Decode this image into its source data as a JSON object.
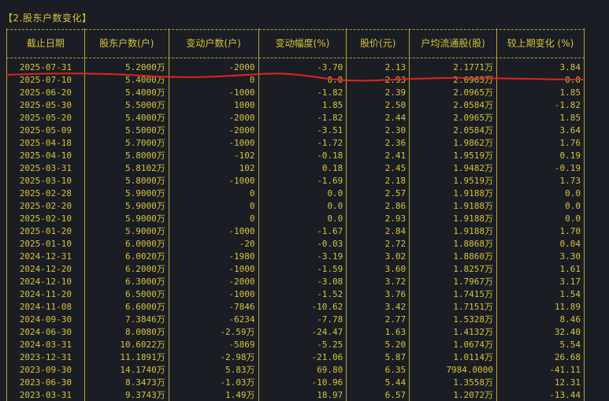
{
  "title": "【2.股东户数变化】",
  "columns": [
    "截止日期",
    "股东户数(户)",
    "变动户数(户)",
    "变动幅度(%)",
    "股价(元)",
    "户均流通股(股)",
    "较上期变化 (%)"
  ],
  "rows": [
    [
      "2025-07-31",
      "5.2000万",
      "-2000",
      "-3.70",
      "2.13",
      "2.1771万",
      "3.84"
    ],
    [
      "2025-07-10",
      "5.4000万",
      "0",
      "0.0",
      "2.93",
      "2.0965万",
      "0.0"
    ],
    [
      "2025-06-20",
      "5.4000万",
      "-1000",
      "-1.82",
      "2.39",
      "2.0965万",
      "1.85"
    ],
    [
      "2025-05-30",
      "5.5000万",
      "1000",
      "1.85",
      "2.50",
      "2.0584万",
      "-1.82"
    ],
    [
      "2025-05-20",
      "5.4000万",
      "-2000",
      "-1.82",
      "2.44",
      "2.0965万",
      "1.85"
    ],
    [
      "2025-05-09",
      "5.5000万",
      "-2000",
      "-3.51",
      "2.30",
      "2.0584万",
      "3.64"
    ],
    [
      "2025-04-18",
      "5.7000万",
      "-1000",
      "-1.72",
      "2.36",
      "1.9862万",
      "1.76"
    ],
    [
      "2025-04-10",
      "5.8000万",
      "-102",
      "-0.18",
      "2.41",
      "1.9519万",
      "0.19"
    ],
    [
      "2025-03-31",
      "5.8102万",
      "102",
      "0.18",
      "2.45",
      "1.9482万",
      "-0.19"
    ],
    [
      "2025-03-10",
      "5.8000万",
      "-1000",
      "-1.69",
      "2.18",
      "1.9519万",
      "1.73"
    ],
    [
      "2025-02-28",
      "5.9000万",
      "0",
      "0.0",
      "2.57",
      "1.9188万",
      "0.0"
    ],
    [
      "2025-02-20",
      "5.9000万",
      "0",
      "0.0",
      "2.86",
      "1.9188万",
      "0.0"
    ],
    [
      "2025-02-10",
      "5.9000万",
      "0",
      "0.0",
      "2.93",
      "1.9188万",
      "0.0"
    ],
    [
      "2025-01-20",
      "5.9000万",
      "-1000",
      "-1.67",
      "2.84",
      "1.9188万",
      "1.70"
    ],
    [
      "2025-01-10",
      "6.0000万",
      "-20",
      "-0.03",
      "2.72",
      "1.8868万",
      "0.04"
    ],
    [
      "2024-12-31",
      "6.0020万",
      "-1980",
      "-3.19",
      "3.02",
      "1.8860万",
      "3.30"
    ],
    [
      "2024-12-20",
      "6.2000万",
      "-1000",
      "-1.59",
      "3.60",
      "1.8257万",
      "1.61"
    ],
    [
      "2024-12-10",
      "6.3000万",
      "-2000",
      "-3.08",
      "3.72",
      "1.7967万",
      "3.17"
    ],
    [
      "2024-11-20",
      "6.5000万",
      "-1000",
      "-1.52",
      "3.76",
      "1.7415万",
      "1.54"
    ],
    [
      "2024-11-08",
      "6.6000万",
      "-7846",
      "-10.62",
      "3.42",
      "1.7151万",
      "11.89"
    ],
    [
      "2024-09-30",
      "7.3846万",
      "-6234",
      "-7.78",
      "2.77",
      "1.5328万",
      "8.46"
    ],
    [
      "2024-06-30",
      "8.0080万",
      "-2.59万",
      "-24.47",
      "1.63",
      "1.4132万",
      "32.40"
    ],
    [
      "2024-03-31",
      "10.6022万",
      "-5869",
      "-5.25",
      "5.20",
      "1.0674万",
      "5.54"
    ],
    [
      "2023-12-31",
      "11.1891万",
      "-2.98万",
      "-21.06",
      "5.87",
      "1.0114万",
      "26.68"
    ],
    [
      "2023-09-30",
      "14.1740万",
      "5.83万",
      "69.80",
      "6.35",
      "7984.0000",
      "-41.11"
    ],
    [
      "2023-06-30",
      "8.3473万",
      "-1.03万",
      "-10.96",
      "5.44",
      "1.3558万",
      "12.31"
    ],
    [
      "2023-03-31",
      "9.3743万",
      "1.49万",
      "18.97",
      "6.57",
      "1.2072万",
      "-13.44"
    ]
  ]
}
